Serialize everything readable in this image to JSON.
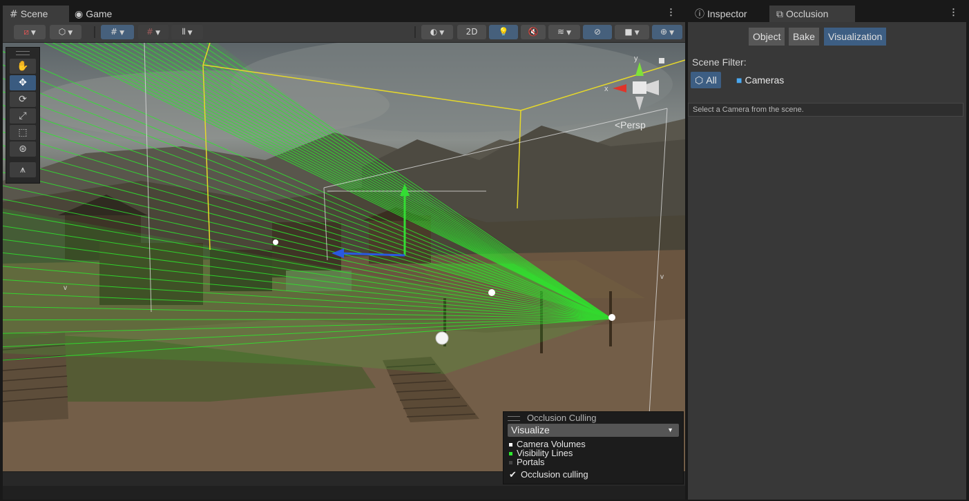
{
  "scene_tabs": [
    {
      "icon": "#",
      "label": "Scene"
    },
    {
      "icon": "◉",
      "label": "Game"
    }
  ],
  "toolbar": {
    "two_d_label": "2D"
  },
  "viewport": {
    "persp_label": "<Persp",
    "gizmo_y": "y",
    "gizmo_x": "x",
    "marker_v": "v"
  },
  "occlusion_overlay": {
    "title": "Occlusion Culling",
    "select_value": "Visualize",
    "legend": [
      {
        "label": "Camera Volumes",
        "color": "#ffffff"
      },
      {
        "label": "Visibility Lines",
        "color": "#2ee82e"
      },
      {
        "label": "Portals",
        "color": "#444444"
      }
    ],
    "checkbox_label": "Occlusion culling",
    "checkbox_checked": true
  },
  "right_tabs": [
    {
      "icon": "ⓘ",
      "label": "Inspector"
    },
    {
      "icon": "⧉",
      "label": "Occlusion"
    }
  ],
  "occlusion_panel": {
    "subtabs": [
      "Object",
      "Bake",
      "Visualization"
    ],
    "active_subtab": "Visualization",
    "scene_filter_label": "Scene Filter:",
    "filter_all": "All",
    "filter_cameras": "Cameras",
    "info_text": "Select a Camera from the scene."
  },
  "colors": {
    "accent": "#3d5e83",
    "visibility_line": "#2ee82e",
    "volume_line": "#e6d82a"
  }
}
